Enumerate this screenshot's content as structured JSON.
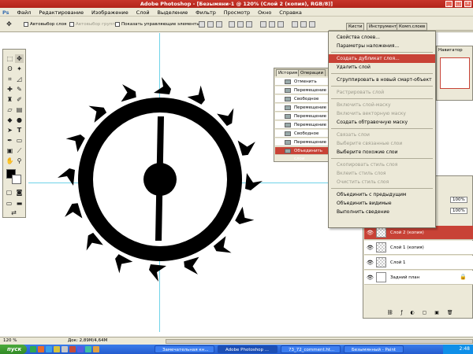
{
  "app": {
    "title": "Adobe Photoshop - [Безымяни-1 @ 120% (Слой 2 (копия), RGB/8)]"
  },
  "window_controls": {
    "minimize": "_",
    "maximize": "□",
    "close": "×"
  },
  "menu": [
    "Файл",
    "Редактирование",
    "Изображение",
    "Слой",
    "Выделение",
    "Фильтр",
    "Просмотр",
    "Окно",
    "Справка"
  ],
  "options_bar": {
    "auto_select_layer": "Автовыбор слоя",
    "auto_select_group": "Автовыбор группы",
    "show_controls": "Показать управляющие элементы"
  },
  "dock_tabs": [
    "Кисти",
    "Инструменты",
    "Комп.слоев"
  ],
  "navigator_label": "Навигатор",
  "history_panel": {
    "tabs": [
      "История",
      "Операции"
    ],
    "items": [
      "Отменить выделение",
      "Перемещение",
      "Свободное Трансф.",
      "Перемещение",
      "Перемещение",
      "Перемещение",
      "Свободное Трансф.",
      "Перемещение",
      "Объединить слои"
    ],
    "selected_index": 8
  },
  "context_menu": {
    "items": [
      {
        "label": "Свойства слоев...",
        "state": "enabled"
      },
      {
        "label": "Параметры наложения...",
        "state": "enabled"
      },
      {
        "label": "Создать дубликат слоя...",
        "state": "highlighted"
      },
      {
        "label": "Удалить слой",
        "state": "enabled"
      },
      {
        "label": "Сгруппировать в новый смарт-объект",
        "state": "enabled"
      },
      {
        "label": "Растрировать слой",
        "state": "disabled"
      },
      {
        "label": "Включить слой-маску",
        "state": "disabled"
      },
      {
        "label": "Включить векторную маску",
        "state": "disabled"
      },
      {
        "label": "Создать обтравочную маску",
        "state": "enabled"
      },
      {
        "label": "Связать слои",
        "state": "disabled"
      },
      {
        "label": "Выберите связанные слои",
        "state": "disabled"
      },
      {
        "label": "Выберите похожие слои",
        "state": "enabled"
      },
      {
        "label": "Скопировать стиль слоя",
        "state": "disabled"
      },
      {
        "label": "Вклеить стиль слоя",
        "state": "disabled"
      },
      {
        "label": "Очистить стиль слоя",
        "state": "disabled"
      },
      {
        "label": "Объединить с предыдущим",
        "state": "enabled"
      },
      {
        "label": "Объединить видимые",
        "state": "enabled"
      },
      {
        "label": "Выполнить сведение",
        "state": "enabled"
      }
    ]
  },
  "layers_panel": {
    "opacity": "100%",
    "fill": "100%",
    "layers": [
      {
        "name": "Слой 2 (копия)",
        "selected": true,
        "locked": false
      },
      {
        "name": "Слой 1 (копия)",
        "selected": false,
        "locked": false
      },
      {
        "name": "Слой 1",
        "selected": false,
        "locked": false
      },
      {
        "name": "Задний план",
        "selected": false,
        "locked": true
      }
    ]
  },
  "status_bar": {
    "zoom": "120 %",
    "doc": "Док: 2,89M/4,64M"
  },
  "taskbar": {
    "start": "пуск",
    "tasks": [
      "Замечательная кн...",
      "Adobe Photoshop ...",
      "73_72_comment.ht...",
      "Безымянный - Paint"
    ],
    "active_index": 1,
    "clock": "2:48"
  },
  "colors": {
    "accent": "#c84236",
    "chrome": "#ece9d8",
    "guide": "#6fd3e8",
    "taskbar": "#245ccf"
  }
}
